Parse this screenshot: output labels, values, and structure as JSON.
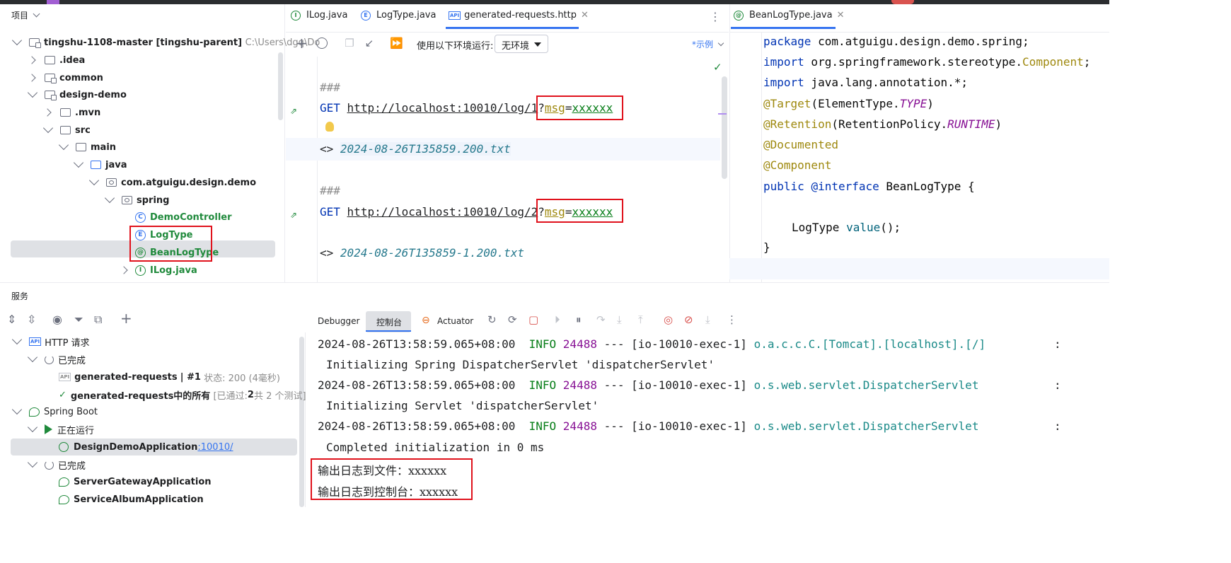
{
  "project": {
    "title": "项目",
    "root": {
      "name": "tingshu-1108-master",
      "qualifier": "[tingshu-parent]",
      "path": "C:\\Users\\dgq\\Do"
    },
    "items": [
      {
        "label": ".idea"
      },
      {
        "label": "common"
      },
      {
        "label": "design-demo"
      },
      {
        "label": ".mvn"
      },
      {
        "label": "src"
      },
      {
        "label": "main"
      },
      {
        "label": "java"
      },
      {
        "label": "com.atguigu.design.demo"
      },
      {
        "label": "spring"
      },
      {
        "label": "DemoController"
      },
      {
        "label": "LogType"
      },
      {
        "label": "BeanLogType"
      },
      {
        "label": "ILog.java"
      }
    ]
  },
  "editor_tabs": [
    {
      "label": "ILog.java",
      "icon": "I"
    },
    {
      "label": "LogType.java",
      "icon": "E"
    },
    {
      "label": "generated-requests.http",
      "icon": "API",
      "active": true
    }
  ],
  "right_tab": {
    "label": "BeanLogType.java",
    "icon": "@"
  },
  "http_toolbar": {
    "env_label": "使用以下环境运行:",
    "env_value": "无环境",
    "example_link": "*示例"
  },
  "http_code": {
    "sep1": "###",
    "method1": "GET",
    "url1": "http://localhost:10010/log/1",
    "q1": "?",
    "param1": "msg",
    "eq1": "=",
    "value1": "xxxxxx",
    "resp_prefix1": "<>",
    "resp_file1": "2024-08-26T135859.200.txt",
    "sep2": "###",
    "method2": "GET",
    "url2": "http://localhost:10010/log/2",
    "q2": "?",
    "param2": "msg",
    "eq2": "=",
    "value2": "xxxxxx",
    "resp_prefix2": "<>",
    "resp_file2": "2024-08-26T135859-1.200.txt"
  },
  "java_code": {
    "l1_kw": "package",
    "l1_rest": " com.atguigu.design.demo.spring;",
    "l2_kw": "import",
    "l2_pre": " org.springframework.stereotype.",
    "l2_ann": "Component",
    "l2_end": ";",
    "l3_kw": "import",
    "l3_rest": " java.lang.annotation.*;",
    "l4_ann": "@Target",
    "l4_pre": "(ElementType.",
    "l4_it": "TYPE",
    "l4_end": ")",
    "l5_ann": "@Retention",
    "l5_pre": "(RetentionPolicy.",
    "l5_it": "RUNTIME",
    "l5_end": ")",
    "l6_ann": "@Documented",
    "l7_ann": "@Component",
    "l8_kw": "public",
    "l8_kw2": "@interface",
    "l8_name": "BeanLogType",
    "l8_end": " {",
    "l9_type": "LogType",
    "l9_fn": "value",
    "l9_end": "();",
    "l10": "}"
  },
  "services": {
    "title": "服务",
    "tree": {
      "http_requests": "HTTP 请求",
      "done1": "已完成",
      "req1_name": "generated-requests",
      "req1_sep": "| #1",
      "req1_status": "状态: 200 (4毫秒)",
      "req2_name": "generated-requests中的所有",
      "req2_status_pre": "[已通过: ",
      "req2_passed": "2",
      "req2_status_post": "共 2 个测试]",
      "spring_boot": "Spring Boot",
      "running": "正在运行",
      "app_running": "DesignDemoApplication",
      "app_port": ":10010/",
      "done2": "已完成",
      "app2": "ServerGatewayApplication",
      "app3": "ServiceAlbumApplication"
    }
  },
  "console": {
    "tabs": [
      "Debugger",
      "控制台",
      "Actuator"
    ],
    "lines": [
      {
        "ts": "2024-08-26T13:58:59.065+08:00",
        "level": "INFO",
        "pid": "24488",
        "sep": "---",
        "thread": "[io-10010-exec-1]",
        "logger": "o.a.c.c.C.[Tomcat].[localhost].[/]",
        "colon": ":",
        "msg": "Initializing Spring DispatcherServlet 'dispatcherServlet'"
      },
      {
        "ts": "2024-08-26T13:58:59.065+08:00",
        "level": "INFO",
        "pid": "24488",
        "sep": "---",
        "thread": "[io-10010-exec-1]",
        "logger": "o.s.web.servlet.DispatcherServlet",
        "colon": ":",
        "msg": "Initializing Servlet 'dispatcherServlet'"
      },
      {
        "ts": "2024-08-26T13:58:59.065+08:00",
        "level": "INFO",
        "pid": "24488",
        "sep": "---",
        "thread": "[io-10010-exec-1]",
        "logger": "o.s.web.servlet.DispatcherServlet",
        "colon": ":",
        "msg": "Completed initialization in 0 ms"
      }
    ],
    "out1": "输出日志到文件：xxxxxx",
    "out2": "输出日志到控制台：xxxxxx"
  },
  "colors": {
    "accent": "#3574f0",
    "highlight_box": "#e0121c",
    "green": "#208a3c"
  }
}
